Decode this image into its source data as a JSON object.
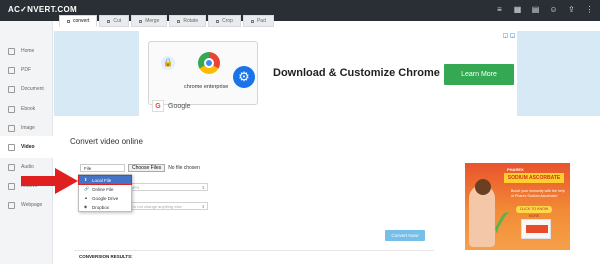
{
  "brand": {
    "logo_text": "AC✓NVERT.COM"
  },
  "topbar_icons": [
    "list-icon",
    "grid-icon",
    "document-icon",
    "user-icon",
    "share-icon",
    "more-icon"
  ],
  "sidebar": {
    "items": [
      {
        "label": "Home",
        "icon": "home-icon"
      },
      {
        "label": "PDF",
        "icon": "pdf-icon"
      },
      {
        "label": "Document",
        "icon": "document-icon"
      },
      {
        "label": "Ebook",
        "icon": "ebook-icon"
      },
      {
        "label": "Image",
        "icon": "image-icon"
      },
      {
        "label": "Video",
        "icon": "video-icon",
        "active": true
      },
      {
        "label": "Audio",
        "icon": "audio-icon"
      },
      {
        "label": "Archive",
        "icon": "archive-icon"
      },
      {
        "label": "Webpage",
        "icon": "webpage-icon"
      }
    ]
  },
  "tabs": [
    {
      "label": "convert",
      "active": true
    },
    {
      "label": "Cut"
    },
    {
      "label": "Merge"
    },
    {
      "label": "Rotate"
    },
    {
      "label": "Crop"
    },
    {
      "label": "Pad"
    }
  ],
  "ad": {
    "product_text": "chrome enterprise",
    "headline": "Download & Customize Chrome",
    "cta": "Learn More",
    "advertiser": "Google"
  },
  "main": {
    "title": "Convert video online",
    "file_select": "File",
    "choose_button": "Choose Files",
    "no_file_text": "No file chosen",
    "format_select": "MP4",
    "option_select": "Do not change anything else",
    "convert_button": "Convert Now!",
    "results_label": "CONVERSION RESULTS:"
  },
  "dropdown": {
    "items": [
      {
        "label": "Local File",
        "icon": "upload-icon",
        "highlighted": true
      },
      {
        "label": "Online File",
        "icon": "link-icon"
      },
      {
        "label": "Google Drive",
        "icon": "google-drive-icon"
      },
      {
        "label": "Dropbox",
        "icon": "dropbox-icon"
      }
    ]
  },
  "right_ad": {
    "brand": "PHAREX",
    "title": "SODIUM ASCORBATE",
    "body": "Boost your immunity with the help of Pharex Sodium Ascorbate!",
    "cta": "CLICK TO KNOW MORE"
  },
  "colors": {
    "topbar": "#2a2f35",
    "accent_green": "#34a853",
    "dropdown_highlight": "#4472c4",
    "arrow_red": "#e02020",
    "convert_button": "#76bfe8"
  }
}
